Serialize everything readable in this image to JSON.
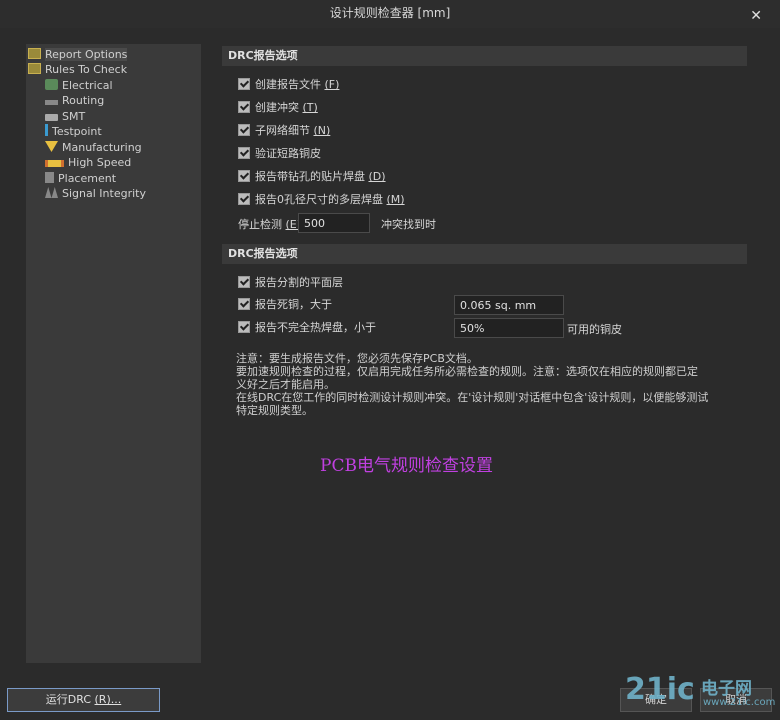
{
  "window": {
    "title": "设计规则检查器 [mm]",
    "close_glyph": "✕"
  },
  "tree": {
    "items": [
      {
        "label": "Report Options",
        "icon": "folder-icon"
      },
      {
        "label": "Rules To Check",
        "icon": "folder-icon"
      },
      {
        "label": "Electrical",
        "icon": "electrical-icon"
      },
      {
        "label": "Routing",
        "icon": "routing-icon"
      },
      {
        "label": "SMT",
        "icon": "smt-icon"
      },
      {
        "label": "Testpoint",
        "icon": "testpoint-icon"
      },
      {
        "label": "Manufacturing",
        "icon": "manufacturing-icon"
      },
      {
        "label": "High Speed",
        "icon": "high-speed-icon"
      },
      {
        "label": "Placement",
        "icon": "placement-icon"
      },
      {
        "label": "Signal Integrity",
        "icon": "signal-integrity-icon"
      }
    ]
  },
  "section1": {
    "title": "DRC报告选项",
    "options": [
      {
        "label": "创建报告文件 ",
        "key": "(F)",
        "checked": true
      },
      {
        "label": "创建冲突 ",
        "key": "(T)",
        "checked": true
      },
      {
        "label": "子网络细节 ",
        "key": "(N)",
        "checked": true
      },
      {
        "label": "验证短路铜皮",
        "key": "",
        "checked": true
      },
      {
        "label": "报告带钻孔的贴片焊盘 ",
        "key": "(D)",
        "checked": true
      },
      {
        "label": "报告0孔径尺寸的多层焊盘 ",
        "key": "(M)",
        "checked": true
      }
    ],
    "stop_label": "停止检测 ",
    "stop_key": "(E)",
    "stop_value": "500",
    "stop_suffix": "冲突找到时"
  },
  "section2": {
    "title": "DRC报告选项",
    "split_plane": {
      "label": "报告分割的平面层",
      "checked": true
    },
    "dead_copper": {
      "label": "报告死铜，大于",
      "value": "0.065 sq. mm",
      "checked": true
    },
    "thermal": {
      "label": "报告不完全热焊盘，小于",
      "value": "50%",
      "suffix": "可用的铜皮",
      "checked": true
    }
  },
  "note": {
    "lines": [
      "注意：要生成报告文件，您必须先保存PCB文档。",
      "要加速规则检查的过程，仅启用完成任务所必需检查的规则。注意：选项仅在相应的规则都已定",
      "义好之后才能启用。",
      "在线DRC在您工作的同时检测设计规则冲突。在'设计规则'对话框中包含'设计规则，以便能够测试",
      "特定规则类型。"
    ]
  },
  "caption": "PCB电气规则检查设置",
  "buttons": {
    "run": "运行DRC ",
    "run_key": "(R)...",
    "ok": "确定",
    "cancel": "取消"
  },
  "watermark": {
    "big": "21ic",
    "cn": "电子网",
    "url": "www.21ic.com"
  },
  "colors": {
    "caption": "#c040e0",
    "accent_border": "#7a9ac8",
    "watermark": "#6fb2c9"
  }
}
